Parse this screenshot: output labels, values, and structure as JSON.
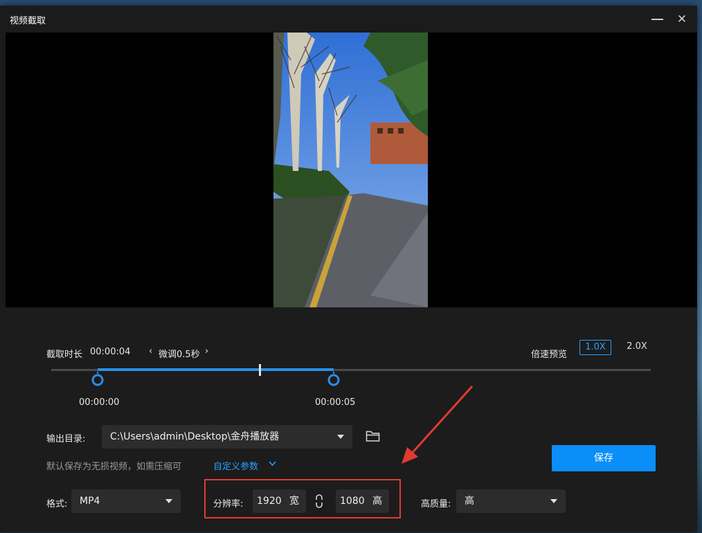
{
  "window": {
    "title": "视频截取"
  },
  "trim": {
    "duration_label": "截取时长",
    "duration_value": "00:00:04",
    "nudge_label": "微调0.5秒",
    "start_time": "00:00:00",
    "end_time": "00:00:05",
    "playhead_fraction": 0.42,
    "selection_end_fraction": 0.47
  },
  "speed": {
    "label": "倍速预览",
    "options": [
      "1.0X",
      "2.0X"
    ],
    "selected": "1.0X"
  },
  "output": {
    "label": "输出目录:",
    "path": "C:\\Users\\admin\\Desktop\\金舟播放器",
    "hint": "默认保存为无损视频，如需压缩可",
    "custom_params": "自定义参数"
  },
  "save_label": "保存",
  "format": {
    "label": "格式:",
    "value": "MP4"
  },
  "resolution": {
    "label": "分辨率:",
    "width": "1920",
    "width_unit": "宽",
    "height": "1080",
    "height_unit": "高"
  },
  "quality": {
    "label": "高质量:",
    "value": "高"
  },
  "colors": {
    "accent": "#2a8ee8",
    "annotation": "#e23a32",
    "save_button": "#0b8ef8"
  }
}
